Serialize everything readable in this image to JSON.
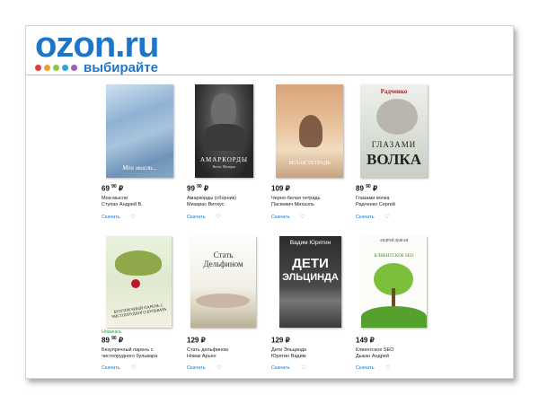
{
  "header": {
    "logo_text": "ozon.ru",
    "tagline": "выбирайте",
    "dot_colors": [
      "#e63a3a",
      "#f2a11a",
      "#8dc63f",
      "#2fa3e0",
      "#a05db3"
    ]
  },
  "books": [
    {
      "price_main": "69",
      "price_kop": "90",
      "currency": "₽",
      "title1": "Мои мысли",
      "title2": "Ступан Андрей В.",
      "cover_text": "Мои мысли...",
      "badge": "",
      "download": "Скачать"
    },
    {
      "price_main": "99",
      "price_kop": "90",
      "currency": "₽",
      "title1": "Амаркорды (сборник)",
      "title2": "Мизарас Витиус",
      "cover_text": "АМАРКОРДЫ",
      "cover_sub": "Витас Мизарас",
      "badge": "",
      "download": "Скачать"
    },
    {
      "price_main": "109",
      "price_kop": "",
      "currency": "₽",
      "title1": "Черно-белая тетрадь",
      "title2": "Паскевич Михаэль",
      "cover_text": "БЕЛАЯ ТЕТРАДЬ",
      "badge": "",
      "download": "Скачать"
    },
    {
      "price_main": "89",
      "price_kop": "90",
      "currency": "₽",
      "title1": "Глазами волка",
      "title2": "Радченко Сергей",
      "cover_text": "ГЛАЗАМИ",
      "cover_text2": "ВОЛКА",
      "cover_author": "Радченко",
      "badge": "",
      "download": "Скачать"
    },
    {
      "price_main": "89",
      "price_kop": "90",
      "currency": "₽",
      "title1": "Безупречный парень с",
      "title2": "чистопрудного бульвара",
      "cover_text": "БЕЗУПРЕЧНЫЙ ПАРЕНЬ С ЧИСТОПРУДНОГО БУЛЬВАРА",
      "badge": "Новинка",
      "download": "Скачать"
    },
    {
      "price_main": "129",
      "price_kop": "",
      "currency": "₽",
      "title1": "Стать дельфином",
      "title2": "Новак Арьен",
      "cover_text": "Стать",
      "cover_text2": "Дельфином",
      "badge": "",
      "download": "Скачать"
    },
    {
      "price_main": "129",
      "price_kop": "",
      "currency": "₽",
      "title1": "Дети Эльцинда",
      "title2": "Юрятин Вадим",
      "cover_text": "ДЕТИ",
      "cover_text2": "ЭЛЬЦИНДА",
      "cover_author": "Вадим Юрятин",
      "badge": "",
      "download": "Скачать"
    },
    {
      "price_main": "149",
      "price_kop": "",
      "currency": "₽",
      "title1": "Клиентское SEO",
      "title2": "Дыкан Андрей",
      "cover_text": "КЛИЕНТСКОЕ SEO",
      "cover_author": "АНДРЕЙ ДЫКАН",
      "badge": "",
      "download": "Скачать"
    }
  ]
}
